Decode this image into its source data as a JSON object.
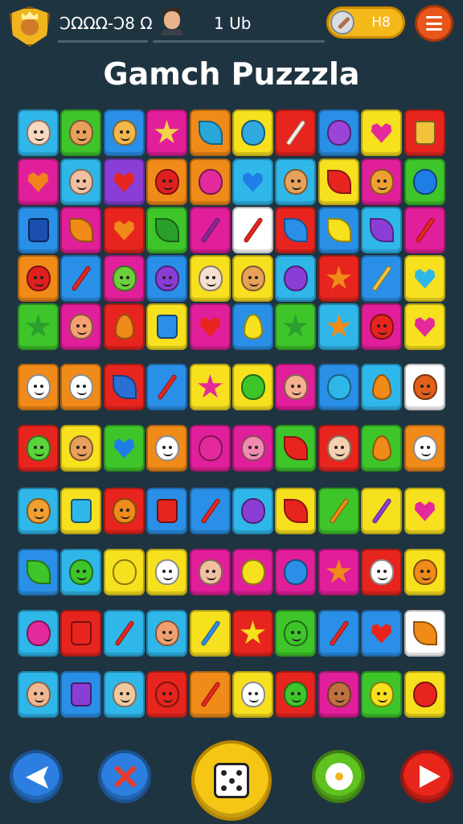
{
  "header": {
    "crest_icon": "fox-crest-icon",
    "score": "ϽΩΩΩ-Ͻ8 Ω",
    "avatar_icon": "player-avatar-icon",
    "level": "1 Ub",
    "coins_icon": "pen-icon",
    "coins": "H8",
    "menu_icon": "hamburger-menu-icon"
  },
  "title": "Gamch Puzzzla",
  "board": {
    "rows": [
      [
        {
          "color": "#2fb7ea",
          "icon": "face",
          "fg": "#f7d8c0"
        },
        {
          "color": "#3ec52a",
          "icon": "face",
          "fg": "#e8a15a"
        },
        {
          "color": "#2a8fe6",
          "icon": "face",
          "fg": "#f2b84b"
        },
        {
          "color": "#e21f9a",
          "icon": "star",
          "fg": "#f5d24a"
        },
        {
          "color": "#f08a18",
          "icon": "leaf",
          "fg": "#2aa7d9"
        },
        {
          "color": "#f7e01e",
          "icon": "blob",
          "fg": "#30a8e0"
        },
        {
          "color": "#e7251e",
          "icon": "stick",
          "fg": "#f3ede0"
        },
        {
          "color": "#2a8fe6",
          "icon": "blob",
          "fg": "#9b44d8"
        },
        {
          "color": "#f7e01e",
          "icon": "heart",
          "fg": "#e32a9c"
        },
        {
          "color": "#e7251e",
          "icon": "jar",
          "fg": "#f4c23a"
        }
      ],
      [
        {
          "color": "#e21f9a",
          "icon": "heart",
          "fg": "#f0831c"
        },
        {
          "color": "#2fb7ea",
          "icon": "face",
          "fg": "#f2c0a0"
        },
        {
          "color": "#8a3ed6",
          "icon": "heart",
          "fg": "#e7251e"
        },
        {
          "color": "#f08a18",
          "icon": "face",
          "fg": "#e02020"
        },
        {
          "color": "#f08a18",
          "icon": "blob",
          "fg": "#e32a9c"
        },
        {
          "color": "#2fb7ea",
          "icon": "heart",
          "fg": "#1f7ee6"
        },
        {
          "color": "#2fb7ea",
          "icon": "face",
          "fg": "#e8a15a"
        },
        {
          "color": "#f7e01e",
          "icon": "leaf",
          "fg": "#e7251e"
        },
        {
          "color": "#e21f9a",
          "icon": "face",
          "fg": "#f0a030"
        },
        {
          "color": "#3ec52a",
          "icon": "blob",
          "fg": "#1f7ee6"
        }
      ],
      [
        {
          "color": "#2a8fe6",
          "icon": "jar",
          "fg": "#1a4fb0"
        },
        {
          "color": "#e21f9a",
          "icon": "leaf",
          "fg": "#f08a18"
        },
        {
          "color": "#e7251e",
          "icon": "heart",
          "fg": "#f08a18"
        },
        {
          "color": "#3ec52a",
          "icon": "leaf",
          "fg": "#2a9f2a"
        },
        {
          "color": "#e21f9a",
          "icon": "stick",
          "fg": "#8a2a9a"
        },
        {
          "color": "#ffffff",
          "icon": "stick",
          "fg": "#e7251e"
        },
        {
          "color": "#e7251e",
          "icon": "leaf",
          "fg": "#2a8fe6"
        },
        {
          "color": "#2a8fe6",
          "icon": "leaf",
          "fg": "#f7e01e"
        },
        {
          "color": "#2fb7ea",
          "icon": "leaf",
          "fg": "#8a3ed6"
        },
        {
          "color": "#e21f9a",
          "icon": "stick",
          "fg": "#e7251e"
        }
      ],
      [
        {
          "color": "#f08a18",
          "icon": "face",
          "fg": "#e02020"
        },
        {
          "color": "#2a8fe6",
          "icon": "stick",
          "fg": "#e7251e"
        },
        {
          "color": "#e21f9a",
          "icon": "face",
          "fg": "#6bd03a"
        },
        {
          "color": "#2a8fe6",
          "icon": "face",
          "fg": "#8a3ed6"
        },
        {
          "color": "#f7e01e",
          "icon": "face",
          "fg": "#f5e0d0"
        },
        {
          "color": "#f7e01e",
          "icon": "face",
          "fg": "#e8a15a"
        },
        {
          "color": "#2fb7ea",
          "icon": "blob",
          "fg": "#8a3ed6"
        },
        {
          "color": "#e7251e",
          "icon": "star",
          "fg": "#f08a18"
        },
        {
          "color": "#2a8fe6",
          "icon": "stick",
          "fg": "#f4c23a"
        },
        {
          "color": "#f7e01e",
          "icon": "heart",
          "fg": "#2fb7ea"
        }
      ],
      [
        {
          "color": "#3ec52a",
          "icon": "star",
          "fg": "#2a9f2a"
        },
        {
          "color": "#e21f9a",
          "icon": "face",
          "fg": "#f4a070"
        },
        {
          "color": "#e7251e",
          "icon": "flame",
          "fg": "#f08a18"
        },
        {
          "color": "#f7e01e",
          "icon": "jar",
          "fg": "#2a8fe6"
        },
        {
          "color": "#e21f9a",
          "icon": "heart",
          "fg": "#e7251e"
        },
        {
          "color": "#2a8fe6",
          "icon": "flame",
          "fg": "#f7e01e"
        },
        {
          "color": "#3ec52a",
          "icon": "star",
          "fg": "#2a9f2a"
        },
        {
          "color": "#2fb7ea",
          "icon": "star",
          "fg": "#f08a18"
        },
        {
          "color": "#e21f9a",
          "icon": "face",
          "fg": "#e7251e"
        },
        {
          "color": "#f7e01e",
          "icon": "heart",
          "fg": "#e32a9c"
        }
      ],
      [
        {
          "color": "#f08a18",
          "icon": "face",
          "fg": "#ffffff"
        },
        {
          "color": "#f08a18",
          "icon": "face",
          "fg": "#ffffff"
        },
        {
          "color": "#e7251e",
          "icon": "leaf",
          "fg": "#2a6fd6"
        },
        {
          "color": "#2a8fe6",
          "icon": "stick",
          "fg": "#e7251e"
        },
        {
          "color": "#f7e01e",
          "icon": "star",
          "fg": "#e32a9c"
        },
        {
          "color": "#f7e01e",
          "icon": "blob",
          "fg": "#3ec52a"
        },
        {
          "color": "#e21f9a",
          "icon": "face",
          "fg": "#f4b090"
        },
        {
          "color": "#2a8fe6",
          "icon": "blob",
          "fg": "#2fb7ea"
        },
        {
          "color": "#2fb7ea",
          "icon": "flame",
          "fg": "#f08a18"
        },
        {
          "color": "#ffffff",
          "icon": "face",
          "fg": "#e0601c"
        }
      ],
      [
        {
          "color": "#e7251e",
          "icon": "face",
          "fg": "#5bd33a"
        },
        {
          "color": "#f7e01e",
          "icon": "face",
          "fg": "#e8a15a"
        },
        {
          "color": "#3ec52a",
          "icon": "heart",
          "fg": "#1f7ee6"
        },
        {
          "color": "#f08a18",
          "icon": "face",
          "fg": "#ffffff"
        },
        {
          "color": "#e21f9a",
          "icon": "blob",
          "fg": "#e32a9c"
        },
        {
          "color": "#e21f9a",
          "icon": "face",
          "fg": "#f08ab0"
        },
        {
          "color": "#3ec52a",
          "icon": "leaf",
          "fg": "#e7251e"
        },
        {
          "color": "#e7251e",
          "icon": "face",
          "fg": "#f4d0b0"
        },
        {
          "color": "#3ec52a",
          "icon": "flame",
          "fg": "#f08a18"
        },
        {
          "color": "#f08a18",
          "icon": "face",
          "fg": "#ffffff"
        }
      ],
      [
        {
          "color": "#2fb7ea",
          "icon": "face",
          "fg": "#f0a030"
        },
        {
          "color": "#f7e01e",
          "icon": "jar",
          "fg": "#2fb7ea"
        },
        {
          "color": "#e7251e",
          "icon": "face",
          "fg": "#f08a18"
        },
        {
          "color": "#2a8fe6",
          "icon": "jar",
          "fg": "#e7251e"
        },
        {
          "color": "#2a8fe6",
          "icon": "stick",
          "fg": "#e7251e"
        },
        {
          "color": "#2fb7ea",
          "icon": "blob",
          "fg": "#8a3ed6"
        },
        {
          "color": "#f7e01e",
          "icon": "leaf",
          "fg": "#e7251e"
        },
        {
          "color": "#3ec52a",
          "icon": "stick",
          "fg": "#f08a18"
        },
        {
          "color": "#f7e01e",
          "icon": "stick",
          "fg": "#8a3ed6"
        },
        {
          "color": "#f7e01e",
          "icon": "heart",
          "fg": "#e32a9c"
        }
      ],
      [
        {
          "color": "#2a8fe6",
          "icon": "leaf",
          "fg": "#3ec52a"
        },
        {
          "color": "#2fb7ea",
          "icon": "face",
          "fg": "#3ec52a"
        },
        {
          "color": "#f7e01e",
          "icon": "blob",
          "fg": "#f7e01e"
        },
        {
          "color": "#f7e01e",
          "icon": "face",
          "fg": "#ffffff"
        },
        {
          "color": "#e21f9a",
          "icon": "face",
          "fg": "#f0c0a0"
        },
        {
          "color": "#e21f9a",
          "icon": "blob",
          "fg": "#f7e01e"
        },
        {
          "color": "#e21f9a",
          "icon": "blob",
          "fg": "#2a8fe6"
        },
        {
          "color": "#e21f9a",
          "icon": "star",
          "fg": "#f08a18"
        },
        {
          "color": "#e7251e",
          "icon": "face",
          "fg": "#ffffff"
        },
        {
          "color": "#f7e01e",
          "icon": "face",
          "fg": "#f08a18"
        }
      ],
      [
        {
          "color": "#2fb7ea",
          "icon": "blob",
          "fg": "#e32a9c"
        },
        {
          "color": "#e7251e",
          "icon": "jar",
          "fg": "#e7251e"
        },
        {
          "color": "#2fb7ea",
          "icon": "stick",
          "fg": "#e7251e"
        },
        {
          "color": "#2fb7ea",
          "icon": "face",
          "fg": "#f0a070"
        },
        {
          "color": "#f7e01e",
          "icon": "stick",
          "fg": "#2a8fe6"
        },
        {
          "color": "#e7251e",
          "icon": "star",
          "fg": "#f7e01e"
        },
        {
          "color": "#3ec52a",
          "icon": "face",
          "fg": "#3ec52a"
        },
        {
          "color": "#2a8fe6",
          "icon": "stick",
          "fg": "#e7251e"
        },
        {
          "color": "#2a8fe6",
          "icon": "heart",
          "fg": "#e7251e"
        },
        {
          "color": "#ffffff",
          "icon": "leaf",
          "fg": "#f08a18"
        }
      ],
      [
        {
          "color": "#2fb7ea",
          "icon": "face",
          "fg": "#f0b890"
        },
        {
          "color": "#2a8fe6",
          "icon": "jar",
          "fg": "#8a3ed6"
        },
        {
          "color": "#2fb7ea",
          "icon": "face",
          "fg": "#f0c8a0"
        },
        {
          "color": "#e7251e",
          "icon": "face",
          "fg": "#e7251e"
        },
        {
          "color": "#f08a18",
          "icon": "stick",
          "fg": "#e7251e"
        },
        {
          "color": "#f7e01e",
          "icon": "face",
          "fg": "#ffffff"
        },
        {
          "color": "#e7251e",
          "icon": "face",
          "fg": "#3ec52a"
        },
        {
          "color": "#e21f9a",
          "icon": "face",
          "fg": "#c07040"
        },
        {
          "color": "#3ec52a",
          "icon": "face",
          "fg": "#f7e01e"
        },
        {
          "color": "#f7e01e",
          "icon": "blob",
          "fg": "#e7251e"
        }
      ]
    ]
  },
  "controls": {
    "back_icon": "back-arrow-icon",
    "shuffle_icon": "shuffle-x-icon",
    "dice_icon": "dice-icon",
    "flower_icon": "flower-icon",
    "play_icon": "play-icon"
  },
  "colors": {
    "background": "#1f3441",
    "accent": "#f6c614",
    "menu": "#e8561c"
  }
}
